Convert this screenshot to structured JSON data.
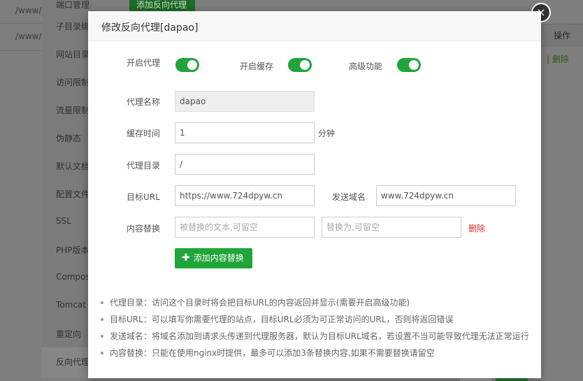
{
  "background": {
    "paths": [
      "/www/",
      "/www/"
    ],
    "menu_items": [
      "端口管理",
      "子目录绑定",
      "网站目录",
      "访问限制",
      "流量限制",
      "伪静态",
      "默认文档",
      "配置文件",
      "SSL",
      "PHP版本",
      "Composer",
      "Tomcat",
      "重定向",
      "反向代理"
    ],
    "top_button": "添加反向代理",
    "action_header": "操作",
    "action_delete": "| 删除"
  },
  "dialog": {
    "title": "修改反向代理[dapao]",
    "close_icon": "×",
    "toggles": [
      {
        "label": "开启代理",
        "on": true
      },
      {
        "label": "开启缓存",
        "on": true
      },
      {
        "label": "高级功能",
        "on": true
      }
    ],
    "form": {
      "proxy_name_label": "代理名称",
      "proxy_name_value": "dapao",
      "cache_time_label": "缓存时间",
      "cache_time_value": "1",
      "cache_time_unit": "分钟",
      "proxy_dir_label": "代理目录",
      "proxy_dir_value": "/",
      "target_url_label": "目标URL",
      "target_url_value": "https://www.724dpyw.cn",
      "send_domain_label": "发送域名",
      "send_domain_value": "www.724dpyw.cn",
      "content_replace_label": "内容替换",
      "replace_from_placeholder": "被替换的文本,可留空",
      "replace_to_placeholder": "替换为,可留空",
      "delete_label": "删除",
      "add_replace_button": "添加内容替换"
    },
    "notes": [
      "代理目录：访问这个目录时将会把目标URL的内容返回并显示(需要开启高级功能)",
      "目标URL：可以填写你需要代理的站点，目标URL必须为可正常访问的URL，否则将返回错误",
      "发送域名：将域名添加到请求头传递到代理服务器，默认为目标URL域名，若设置不当可能导致代理无法正常运行",
      "内容替换：只能在使用nginx时提供，最多可以添加3条替换内容,如果不需要替换请留空"
    ],
    "colors": {
      "accent": "#20a53a",
      "danger": "#e02b2b"
    }
  }
}
